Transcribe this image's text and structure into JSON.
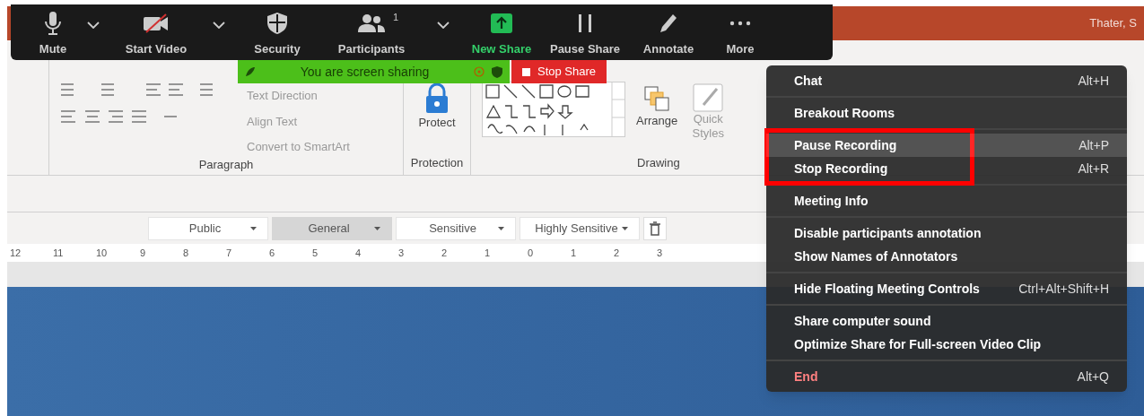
{
  "title_bar": {
    "user": "Thater, S"
  },
  "toolbar": {
    "buttons": [
      {
        "kind": "mic",
        "label": "Mute",
        "caret": true
      },
      {
        "kind": "video",
        "label": "Start Video",
        "caret": true
      },
      {
        "kind": "shield",
        "label": "Security",
        "caret": false
      },
      {
        "kind": "people",
        "label": "Participants",
        "badge": "1",
        "caret": true
      },
      {
        "kind": "share",
        "label": "New Share",
        "caret": false
      },
      {
        "kind": "pause",
        "label": "Pause Share",
        "caret": false
      },
      {
        "kind": "pencil",
        "label": "Annotate",
        "caret": false
      },
      {
        "kind": "dots",
        "label": "More",
        "caret": false
      }
    ]
  },
  "share_banner": {
    "text": "You are screen sharing",
    "stop_button": "Stop Share"
  },
  "ribbon": {
    "paragraph": {
      "commands": [
        "Text Direction",
        "Align Text",
        "Convert to SmartArt"
      ],
      "group_label": "Paragraph"
    },
    "protection": {
      "command": "Protect",
      "group_label": "Protection"
    },
    "drawing": {
      "commands": [
        "Arrange",
        "Quick Styles"
      ],
      "group_label": "Drawing"
    }
  },
  "sensitivity_bar": {
    "labels": [
      {
        "text": "Public",
        "selected": false
      },
      {
        "text": "General",
        "selected": true
      },
      {
        "text": "Sensitive",
        "selected": false
      },
      {
        "text": "Highly Sensitive",
        "selected": false
      }
    ]
  },
  "ruler": [
    "12",
    "11",
    "10",
    "9",
    "8",
    "7",
    "6",
    "5",
    "4",
    "3",
    "2",
    "1",
    "0",
    "1",
    "2",
    "3"
  ],
  "more_menu": {
    "groups": [
      {
        "outlined": false,
        "items": [
          {
            "label": "Chat",
            "shortcut": "Alt+H",
            "hovered": false,
            "danger": false
          }
        ]
      },
      {
        "outlined": false,
        "items": [
          {
            "label": "Breakout Rooms",
            "hovered": false,
            "danger": false
          }
        ]
      },
      {
        "outlined": true,
        "items": [
          {
            "label": "Pause Recording",
            "shortcut": "Alt+P",
            "hovered": true,
            "danger": false
          },
          {
            "label": "Stop Recording",
            "shortcut": "Alt+R",
            "hovered": false,
            "danger": false
          }
        ]
      },
      {
        "outlined": false,
        "items": [
          {
            "label": "Meeting Info",
            "hovered": false,
            "danger": false
          }
        ]
      },
      {
        "outlined": false,
        "items": [
          {
            "label": "Disable participants annotation",
            "hovered": false,
            "danger": false
          },
          {
            "label": "Show Names of Annotators",
            "hovered": false,
            "danger": false
          }
        ]
      },
      {
        "outlined": false,
        "items": [
          {
            "label": "Hide Floating Meeting Controls",
            "shortcut": "Ctrl+Alt+Shift+H",
            "hovered": false,
            "danger": false
          }
        ]
      },
      {
        "outlined": false,
        "items": [
          {
            "label": "Share computer sound",
            "hovered": false,
            "danger": false
          },
          {
            "label": "Optimize Share for Full-screen Video Clip",
            "hovered": false,
            "danger": false
          }
        ]
      },
      {
        "outlined": false,
        "items": [
          {
            "label": "End",
            "shortcut": "Alt+Q",
            "hovered": false,
            "danger": true
          }
        ]
      }
    ]
  }
}
